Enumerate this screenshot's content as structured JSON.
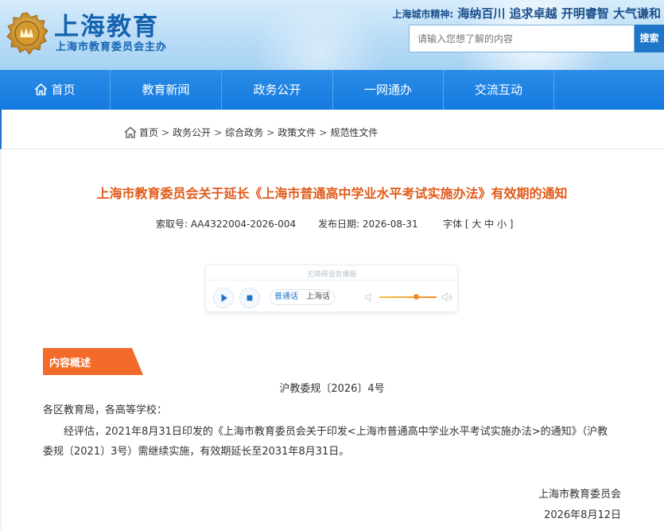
{
  "header": {
    "site_title": "上海教育",
    "site_subtitle": "上海市教育委员会主办",
    "spirit_label": "上海城市精神:",
    "spirit_value": "海纳百川 追求卓越 开明睿智 大气谦和",
    "search_placeholder": "请输入您想了解的内容",
    "search_button": "搜索"
  },
  "nav": {
    "items": [
      {
        "label": "首页"
      },
      {
        "label": "教育新闻"
      },
      {
        "label": "政务公开"
      },
      {
        "label": "一网通办"
      },
      {
        "label": "交流互动"
      }
    ]
  },
  "breadcrumb": {
    "items": [
      "首页",
      "政务公开",
      "综合政务",
      "政策文件",
      "规范性文件"
    ],
    "separator": ">"
  },
  "article": {
    "title": "上海市教育委员会关于延长《上海市普通高中学业水平考试实施办法》有效期的通知",
    "index_label": "索取号:",
    "index_value": "AA4322004-2026-004",
    "date_label": "发布日期:",
    "date_value": "2026-08-31",
    "font_label": "字体",
    "font_options": "[ 大 中 小 ]"
  },
  "player": {
    "caption": "无障碍语音播报",
    "lang_mandarin": "普通话",
    "lang_shanghai": "上海话",
    "volume_fraction": 0.65
  },
  "content": {
    "section_tag": "内容概述",
    "doc_number": "沪教委规〔2026〕4号",
    "salutation": "各区教育局，各高等学校：",
    "para_line1": "经评估，2021年8月31日印发的《上海市教育委员会关于印发<上海市普通高中学业水平考试实施办法>的通知》（沪教",
    "para_line2": "委规〔2021〕3号）需继续实施，有效期延长至2031年8月31日。",
    "signature": "上海市教育委员会",
    "sign_date": "2026年8月12日"
  },
  "colors": {
    "brand_blue": "#1f76c8",
    "title_orange": "#e05a1a",
    "tag_orange": "#f26b2a"
  }
}
